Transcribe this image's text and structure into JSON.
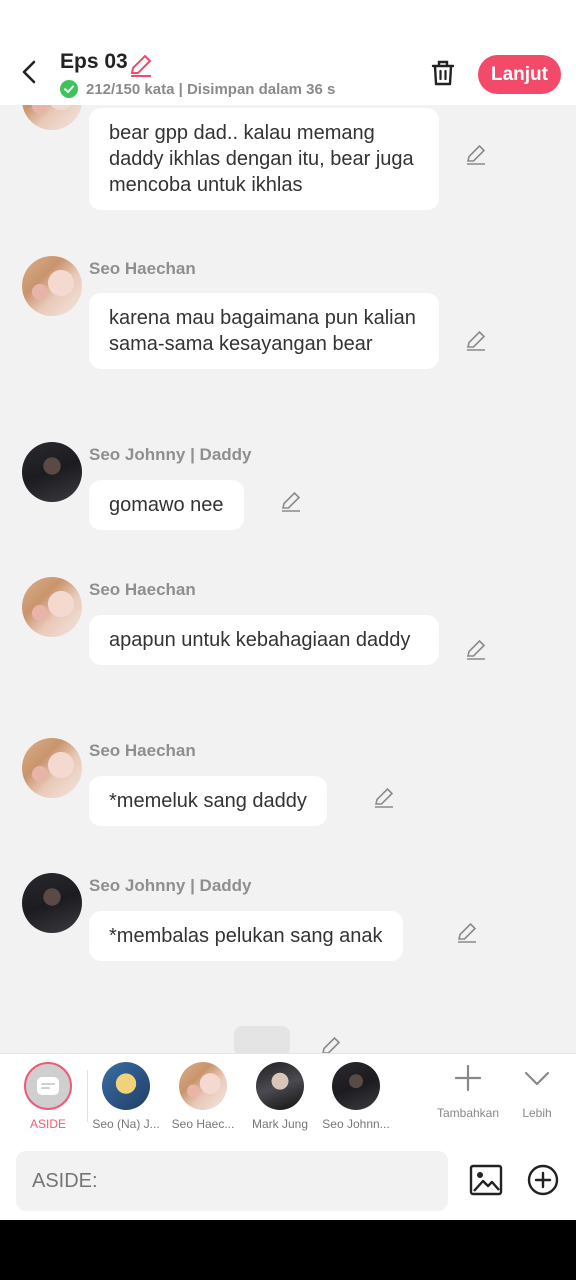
{
  "header": {
    "title": "Eps 03",
    "meta": "212/150 kata | Disimpan dalam 36 s",
    "next_label": "Lanjut"
  },
  "messages": [
    {
      "name": "",
      "text": "bear gpp dad.. kalau memang daddy ikhlas dengan itu, bear juga mencoba untuk ikhlas"
    },
    {
      "name": "Seo Haechan",
      "text": "karena mau bagaimana pun kalian sama-sama kesayangan bear"
    },
    {
      "name": "Seo Johnny | Daddy",
      "text": "gomawo nee"
    },
    {
      "name": "Seo Haechan",
      "text": "apapun untuk kebahagiaan daddy"
    },
    {
      "name": "Seo Haechan",
      "text": "*memeluk sang daddy"
    },
    {
      "name": "Seo Johnny | Daddy",
      "text": "*membalas pelukan sang anak"
    }
  ],
  "cast": [
    {
      "label": "ASIDE"
    },
    {
      "label": "Seo (Na) J..."
    },
    {
      "label": "Seo Haec..."
    },
    {
      "label": "Mark Jung"
    },
    {
      "label": "Seo Johnn..."
    }
  ],
  "tools": {
    "add_label": "Tambahkan",
    "more_label": "Lebih"
  },
  "input": {
    "placeholder": "ASIDE:"
  },
  "colors": {
    "accent": "#f34a6a",
    "aside_ring": "#f05a76",
    "check": "#3cc45b"
  }
}
